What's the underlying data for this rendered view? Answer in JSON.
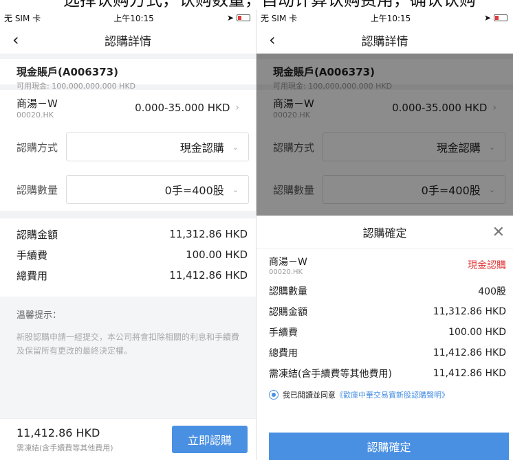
{
  "top_strip": "选择认购方式，认购数量，自动计算认购费用，确认认购",
  "status_bar": {
    "carrier": "无 SIM 卡",
    "time": "上午10:15"
  },
  "nav": {
    "title": "認購詳情"
  },
  "account": {
    "name": "現金賬戶(A006373)",
    "cash": "可用現金: 100,000,000.000 HKD"
  },
  "stock": {
    "name": "商湯－W",
    "code": "00020.HK",
    "price_range": "0.000-35.000 HKD"
  },
  "form": {
    "method_label": "認購方式",
    "method_value": "現金認購",
    "qty_label": "認購數量",
    "qty_value": "0手=400股"
  },
  "cost": [
    {
      "label": "認購金額",
      "value": "11,312.86 HKD"
    },
    {
      "label": "手續費",
      "value": "100.00 HKD"
    },
    {
      "label": "總費用",
      "value": "11,412.86 HKD"
    }
  ],
  "tips": {
    "title": "溫馨提示：",
    "text": "新股認購申請一經提交，本公司將會扣除相關的利息和手續費及保留所有更改的最終決定權。"
  },
  "bottom": {
    "amount": "11,412.86 HKD",
    "freeze_label": "需凍結(含手續費等其他費用)",
    "buy_button": "立即認購"
  },
  "confirm": {
    "title": "認購確定",
    "method": "現金認購",
    "rows": [
      {
        "label": "認購數量",
        "value": "400股"
      },
      {
        "label": "認購金額",
        "value": "11,312.86 HKD"
      },
      {
        "label": "手續費",
        "value": "100.00 HKD"
      },
      {
        "label": "總費用",
        "value": "11,412.86 HKD"
      },
      {
        "label": "需凍結(含手續費等其他費用)",
        "value": "11,412.86 HKD"
      }
    ],
    "agree_prefix": "我已閱讀並同意",
    "agree_link": "《歡庫中華交易寶新股認購聲明》",
    "button": "認購確定"
  },
  "colors": {
    "accent": "#4a90e2",
    "warning": "#e23b3b"
  }
}
